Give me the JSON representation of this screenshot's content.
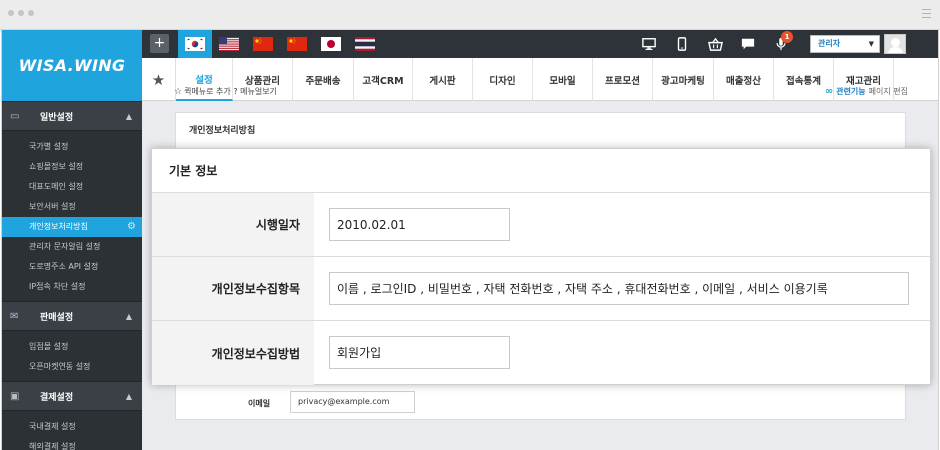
{
  "brand": {
    "logo": "WISA.WING",
    "accent": "#1fa4de"
  },
  "topbar": {
    "add_label": "+",
    "flags": [
      {
        "name": "korea",
        "active": true
      },
      {
        "name": "usa",
        "active": false
      },
      {
        "name": "china",
        "active": false
      },
      {
        "name": "china-2",
        "active": false
      },
      {
        "name": "japan",
        "active": false
      },
      {
        "name": "thailand",
        "active": false
      }
    ],
    "icons": [
      "monitor-icon",
      "mobile-icon",
      "basket-icon",
      "chat-icon",
      "microphone-icon"
    ],
    "notification_count": "1",
    "admin_label": "관리자"
  },
  "nav": {
    "tabs": [
      "설정",
      "상품관리",
      "주문배송",
      "고객CRM",
      "게시판",
      "디자인",
      "모바일",
      "프로모션",
      "광고마케팅",
      "매출정산",
      "접속통계",
      "재고관리"
    ],
    "active_tab": "설정"
  },
  "sidebar": {
    "sections": [
      {
        "title": "일반설정",
        "icon": "window-icon",
        "items": [
          "국가별 설정",
          "쇼핑몰정보 설정",
          "대표도메인 설정",
          "보안서버 설정",
          "개인정보처리방침",
          "관리자 문자알림 설정",
          "도로명주소 API 설정",
          "IP접속 차단 설정"
        ],
        "active_item": "개인정보처리방침"
      },
      {
        "title": "판매설정",
        "icon": "envelope-icon",
        "items": [
          "입점몰 설정",
          "오픈마켓연동 설정"
        ]
      },
      {
        "title": "결제설정",
        "icon": "wallet-icon",
        "items": [
          "국내결제 설정",
          "해외결제 설정"
        ]
      }
    ]
  },
  "content": {
    "quick_links": "퀵메뉴로 추가 ? 메뉴얼보기",
    "related_label": "관련기능",
    "page_edit_label": "페이지 편집",
    "panel_title": "개인정보처리방침",
    "email_label": "이메일",
    "email_value": "privacy@example.com"
  },
  "modal": {
    "title": "기본 정보",
    "rows": [
      {
        "label": "시행일자",
        "value": "2010.02.01"
      },
      {
        "label": "개인정보수집항목",
        "value": "이름 , 로그인ID , 비밀번호 , 자택 전화번호 , 자택 주소 , 휴대전화번호 , 이메일 , 서비스 이용기록"
      },
      {
        "label": "개인정보수집방법",
        "value": "회원가입"
      }
    ]
  }
}
